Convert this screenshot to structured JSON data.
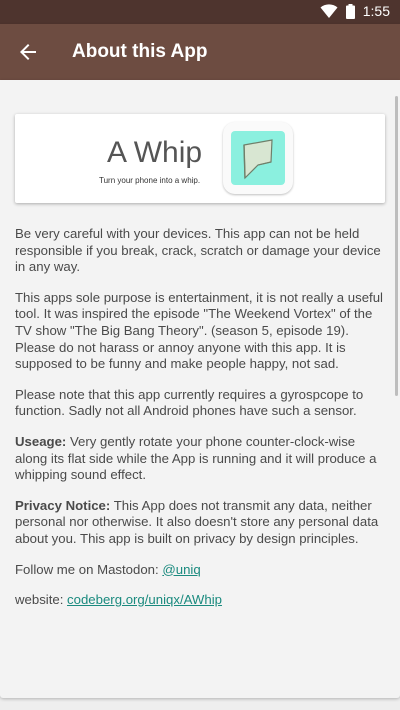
{
  "status_bar": {
    "time": "1:55",
    "icons": [
      "wifi-icon",
      "battery-icon"
    ]
  },
  "app_bar": {
    "title": "About this App",
    "back_icon": "back-arrow-icon"
  },
  "header": {
    "app_name": "A Whip",
    "tagline": "Turn your phone into a whip.",
    "logo_icon": "whip-logo-icon"
  },
  "paragraphs": {
    "disclaimer": "Be very careful with your devices. This app can not be held responsible if you break, crack, scratch or damage your device in any way.",
    "purpose": "This apps sole purpose is entertainment, it is not really a useful tool. It was inspired the episode \"The Weekend Vortex\" of the TV show \"The Big Bang Theory\". (season 5, episode 19). Please do not harass or annoy anyone with this app. It is supposed to be funny and make people happy, not sad.",
    "sensor_note": "Please note that this app currently requires a gyrospcope to function. Sadly not all Android phones have such a sensor.",
    "usage_label": "Useage:",
    "usage_text": " Very gently rotate your phone counter-clock-wise along its flat side while the App is running and it will produce a whipping sound effect.",
    "privacy_label": "Privacy Notice:",
    "privacy_text": " This App does not transmit any data, neither personal nor otherwise. It also doesn't store any personal data about you. This app is built on privacy by design principles.",
    "follow_text": "Follow me on Mastodon: ",
    "follow_link": "@uniq",
    "website_text": "website: ",
    "website_link": "codeberg.org/uniqx/AWhip"
  },
  "colors": {
    "status_bar": "#4e342e",
    "app_bar": "#6d4c41",
    "link": "#1a8a7e",
    "logo_fill": "#8bf0df"
  }
}
